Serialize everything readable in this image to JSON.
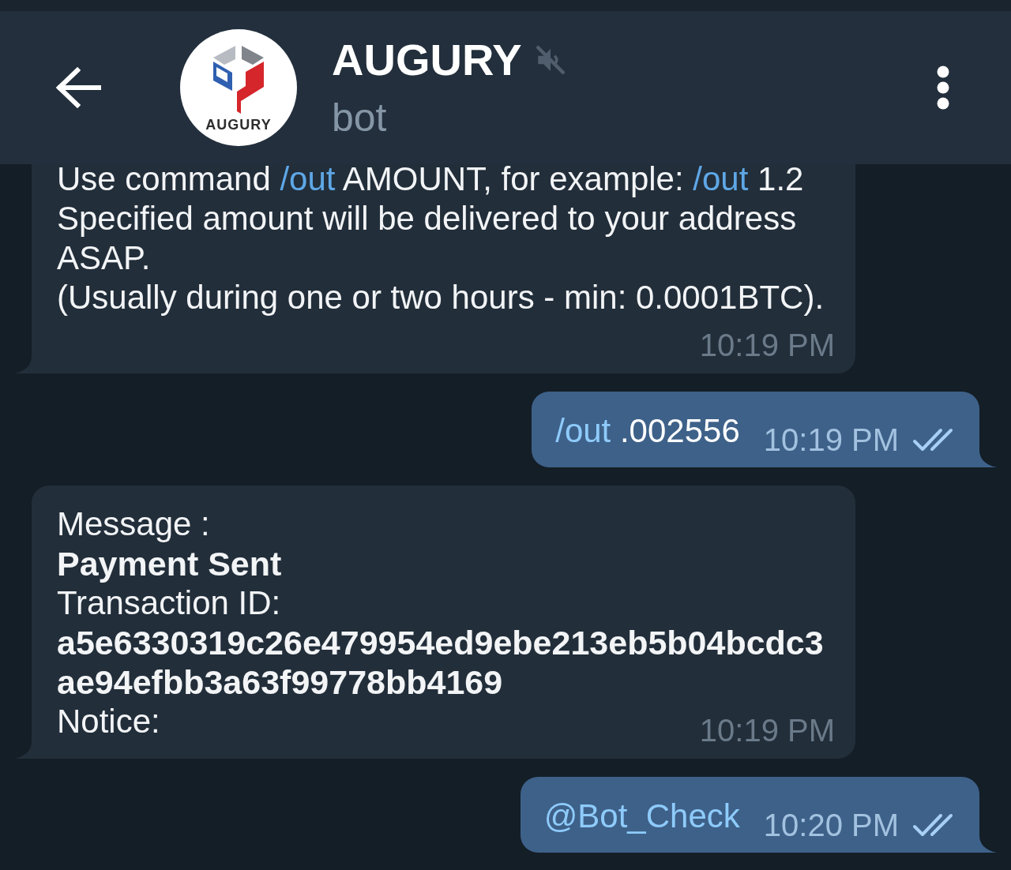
{
  "header": {
    "title": "AUGURY",
    "muted": true,
    "subtitle": "bot",
    "avatar_label": "AUGURY"
  },
  "messages": [
    {
      "kind": "incoming",
      "lines": [
        [
          {
            "kind": "text",
            "text": "Use command "
          },
          {
            "kind": "command",
            "text": "/out"
          },
          {
            "kind": "text",
            "text": " AMOUNT, for example: "
          },
          {
            "kind": "command",
            "text": "/out"
          },
          {
            "kind": "text",
            "text": " 1.2"
          }
        ],
        [
          {
            "kind": "text",
            "text": "Specified amount will be delivered to your address ASAP."
          }
        ],
        [
          {
            "kind": "text",
            "text": "(Usually during one or two hours - min: 0.0001BTC)."
          }
        ]
      ],
      "time": "10:19 PM"
    },
    {
      "kind": "outgoing",
      "lines": [
        [
          {
            "kind": "command",
            "text": "/out"
          },
          {
            "kind": "text",
            "text": " .002556"
          }
        ]
      ],
      "time": "10:19 PM",
      "read": true
    },
    {
      "kind": "incoming",
      "lines": [
        [
          {
            "kind": "text",
            "text": "Message :"
          }
        ],
        [
          {
            "kind": "bold",
            "text": "Payment Sent"
          }
        ],
        [
          {
            "kind": "text",
            "text": "Transaction ID:"
          }
        ],
        [
          {
            "kind": "bold",
            "text": "a5e6330319c26e479954ed9ebe213eb5b04bcdc3ae94efbb3a63f99778bb4169"
          }
        ],
        [
          {
            "kind": "text",
            "text": "Notice:"
          }
        ]
      ],
      "time": "10:19 PM"
    },
    {
      "kind": "outgoing",
      "lines": [
        [
          {
            "kind": "mention",
            "text": "@Bot_Check"
          }
        ]
      ],
      "time": "10:20 PM",
      "read": true
    }
  ]
}
